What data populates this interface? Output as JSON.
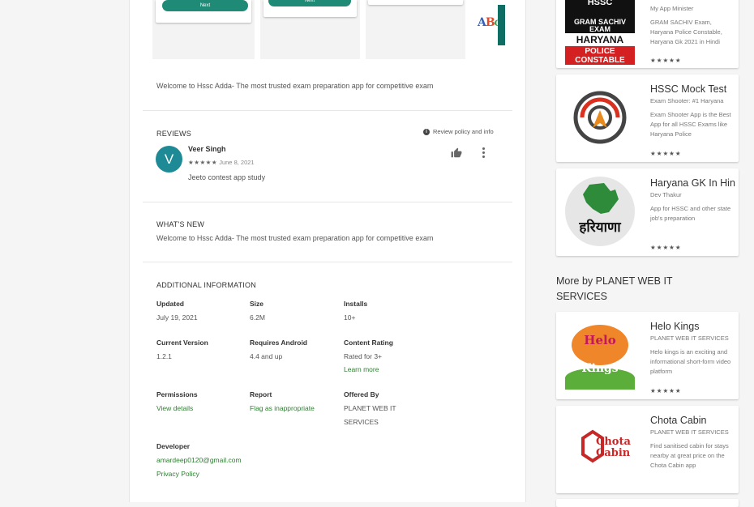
{
  "screenshots": {
    "btn1": "Next",
    "btn2": "Next",
    "abc": "ABC"
  },
  "description": "Welcome to Hssc Adda- The most trusted exam preparation app for competitive exam",
  "reviews": {
    "title": "REVIEWS",
    "policy": "Review policy and info",
    "items": [
      {
        "avatar": "V",
        "name": "Veer Singh",
        "stars": "★★★★★",
        "date": "June 8, 2021",
        "text": "Jeeto contest app study"
      }
    ]
  },
  "whats_new": {
    "title": "WHAT'S NEW",
    "text": "Welcome to Hssc Adda- The most trusted exam preparation app for competitive exam"
  },
  "additional_info": {
    "title": "ADDITIONAL INFORMATION",
    "updated_label": "Updated",
    "updated": "July 19, 2021",
    "size_label": "Size",
    "size": "6.2M",
    "installs_label": "Installs",
    "installs": "10+",
    "version_label": "Current Version",
    "version": "1.2.1",
    "requires_label": "Requires Android",
    "requires": "4.4 and up",
    "content_label": "Content Rating",
    "content": "Rated for 3+",
    "learn_more": "Learn more",
    "permissions_label": "Permissions",
    "permissions": "View details",
    "report_label": "Report",
    "report": "Flag as inappropriate",
    "offered_label": "Offered By",
    "offered_1": "PLANET WEB IT",
    "offered_2": "SERVICES",
    "developer_label": "Developer",
    "email": "amardeep0120@gmail.com",
    "privacy": "Privacy Policy"
  },
  "similar_apps": [
    {
      "title": "",
      "dev": "My App Minister",
      "blurb": "GRAM SACHIV Exam, Haryana Police Constable, Haryana Gk 2021 in Hindi",
      "rating": "★★★★★",
      "icon": "hssc-gram-sachiv-icon",
      "icon_text": {
        "l1": "HSSC",
        "l2": "GRAM SACHIV",
        "l3": "EXAM",
        "l4": "HARYANA",
        "l5": "POLICE",
        "l6": "CONSTABLE"
      }
    },
    {
      "title": "HSSC Mock Test",
      "dev": "Exam Shooter: #1 Haryana",
      "blurb": "Exam Shooter App is the Best App for all HSSC Exams like Haryana Police",
      "rating": "★★★★★",
      "icon": "exam-shooter-target-icon"
    },
    {
      "title": "Haryana GK In Hindi",
      "dev": "Dev Thakur",
      "blurb": "App for HSSC and other state job's preparation",
      "rating": "★★★★★",
      "icon": "haryana-map-icon",
      "icon_text": "हरियाणा"
    }
  ],
  "more_by": {
    "title": "More by PLANET WEB IT SERVICES",
    "apps": [
      {
        "title": "Helo Kings",
        "dev": "PLANET WEB IT SERVICES",
        "blurb": "Helo kings is an exciting and informational short-form video platform",
        "rating": "★★★★★",
        "icon": "helo-kings-icon",
        "icon_text": {
          "l1": "Helo",
          "l2": "Kings"
        }
      },
      {
        "title": "Chota Cabin",
        "dev": "PLANET WEB IT SERVICES",
        "blurb": "Find sanitised cabin for stays nearby at great price on the Chota Cabin app",
        "rating": "★★★★★",
        "icon": "chota-cabin-icon",
        "icon_text": {
          "l1": "Chota",
          "l2": "Cabin"
        }
      }
    ]
  },
  "colors": {
    "accent_green": "#1f8b76",
    "link_green": "#2f7d32",
    "avatar_teal": "#1e8a96",
    "police_red": "#d42020"
  }
}
